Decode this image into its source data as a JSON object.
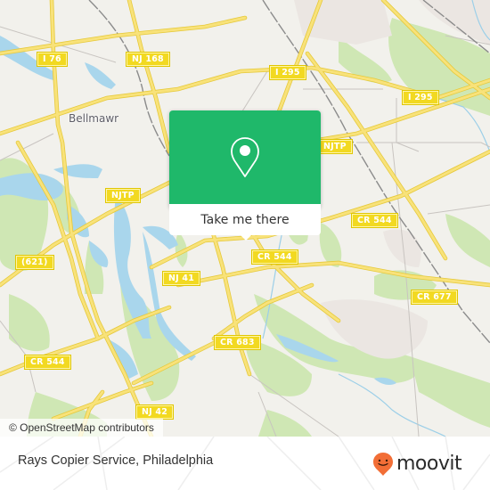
{
  "map": {
    "place_labels": [
      {
        "id": "bellmawr",
        "text": "Bellmawr"
      }
    ],
    "route_labels": [
      {
        "id": "i76",
        "text": "I 76"
      },
      {
        "id": "nj168",
        "text": "NJ 168"
      },
      {
        "id": "i295-a",
        "text": "I 295"
      },
      {
        "id": "i295-b",
        "text": "I 295"
      },
      {
        "id": "njtp-a",
        "text": "NJTP"
      },
      {
        "id": "njtp-b",
        "text": "NJTP"
      },
      {
        "id": "cr544-a",
        "text": "CR 544"
      },
      {
        "id": "cr544-b",
        "text": "CR 544"
      },
      {
        "id": "cr544-c",
        "text": "CR 544"
      },
      {
        "id": "cr621",
        "text": "(621)"
      },
      {
        "id": "nj41",
        "text": "NJ 41"
      },
      {
        "id": "cr677",
        "text": "CR 677"
      },
      {
        "id": "cr683",
        "text": "CR 683"
      },
      {
        "id": "nj42",
        "text": "NJ 42"
      }
    ],
    "colors": {
      "land": "#f2f1ec",
      "park": "#c8e6a8",
      "water": "#a8d8ee",
      "road": "#f5dc55",
      "route_label": "#f2d921"
    }
  },
  "popup": {
    "icon": "map-pin-icon",
    "button_label": "Take me there",
    "accent_color": "#1fb86a"
  },
  "attribution": {
    "text": "© OpenStreetMap contributors"
  },
  "footer": {
    "place_title": "Rays Copier Service, Philadelphia",
    "logo": {
      "icon": "moovit-smiley-pin-icon",
      "text": "moovit",
      "color": "#f26e36"
    }
  }
}
